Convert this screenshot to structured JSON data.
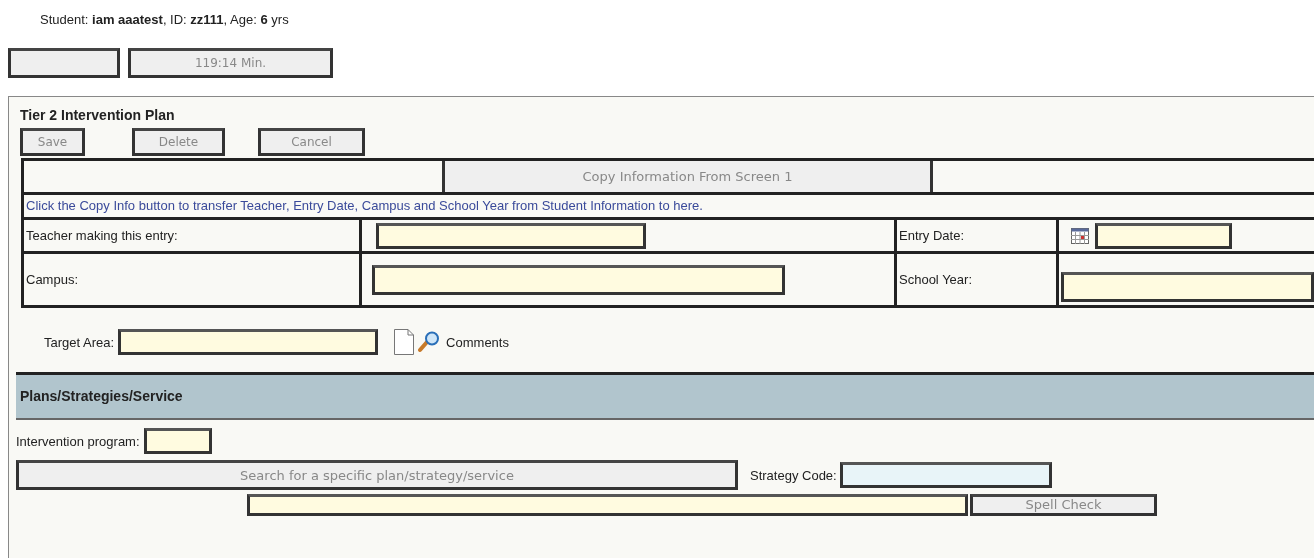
{
  "student_line": "Student: **iam aaatest**, ID: **zz111**, Age: **6** yrs",
  "timer": "119:14 Min.",
  "plan": {
    "title": "Tier 2 Intervention Plan",
    "actions": [
      "Save",
      "Delete",
      "Cancel"
    ],
    "copy_button": "Copy Information From Screen 1",
    "copy_note": "Click the Copy Info button to transfer Teacher, Entry Date, Campus and School Year from Student Information to here.",
    "fields": [
      {
        "label": "Teacher making this entry:",
        "kind": "text"
      },
      {
        "label": "Entry Date:",
        "kind": "date"
      },
      {
        "label": "Campus:",
        "kind": "text"
      },
      {
        "label": "School Year:",
        "kind": "text"
      }
    ],
    "target_area": {
      "label": "Target Area:",
      "comments": "Comments"
    }
  },
  "section": {
    "title": "Plans/Strategies/Service",
    "intervention_label": "Intervention program:",
    "search_button": "Search for a specific plan/strategy/service",
    "strategy_label": "Strategy Code:",
    "spell_button": "Spell Check"
  }
}
